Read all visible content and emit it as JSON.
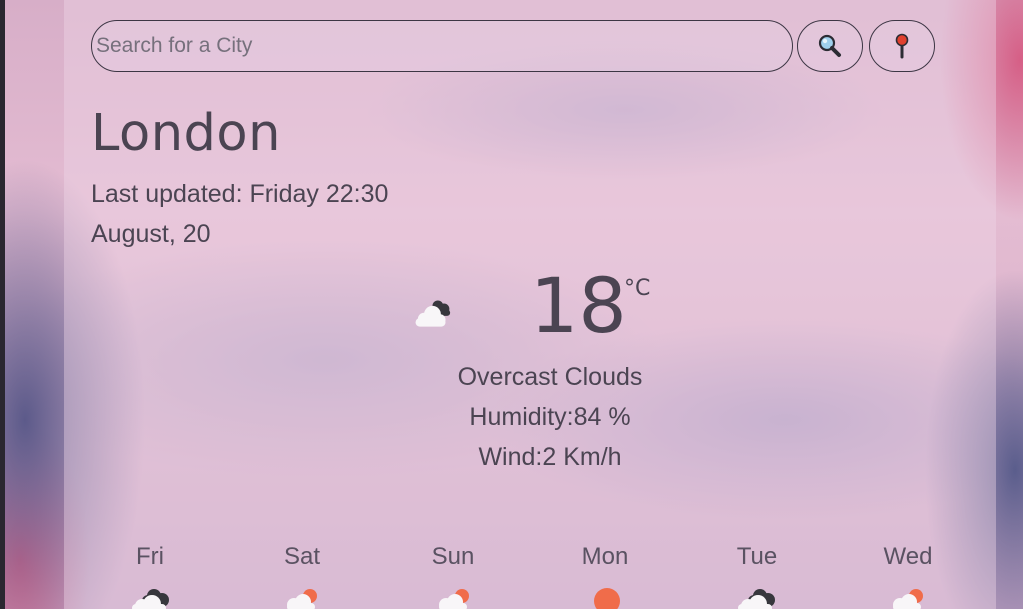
{
  "search": {
    "placeholder": "Search for a City"
  },
  "buttons": {
    "search_icon": "magnifier-icon",
    "location_icon": "location-pin-icon"
  },
  "location": {
    "city": "London",
    "last_updated": "Last updated: Friday 22:30",
    "date": "August, 20"
  },
  "current": {
    "temperature": "18",
    "unit": "°C",
    "condition": "Overcast Clouds",
    "humidity": "Humidity:84 %",
    "wind": "Wind:2 Km/h",
    "icon": "overcast-clouds-icon"
  },
  "forecast": [
    {
      "day": "Fri",
      "icon": "dark-clouds-icon"
    },
    {
      "day": "Sat",
      "icon": "cloud-sun-icon"
    },
    {
      "day": "Sun",
      "icon": "cloud-sun-icon"
    },
    {
      "day": "Mon",
      "icon": "sun-icon"
    },
    {
      "day": "Tue",
      "icon": "dark-clouds-icon"
    },
    {
      "day": "Wed",
      "icon": "cloud-sun-icon"
    }
  ],
  "colors": {
    "text": "#4b4452",
    "sun": "#f06c4a",
    "cloud_light": "#f7f5f7",
    "cloud_dark": "#3a3a40"
  }
}
